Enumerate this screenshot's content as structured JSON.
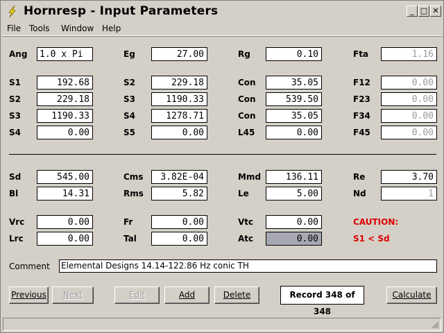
{
  "window": {
    "title": "Hornresp - Input Parameters",
    "controls": {
      "minimize": "_",
      "maximize": "□",
      "close": "✕"
    }
  },
  "menu": [
    "File",
    "Tools",
    "Window",
    "Help"
  ],
  "labels": {
    "ang": "Ang",
    "eg": "Eg",
    "rg": "Rg",
    "fta": "Fta",
    "c1_s1": "S1",
    "c1_s2": "S2",
    "c1_s3": "S3",
    "c1_s4": "S4",
    "c2_s2": "S2",
    "c2_s3": "S3",
    "c2_s4": "S4",
    "c2_s5": "S5",
    "con1": "Con",
    "con2": "Con",
    "con3": "Con",
    "l45": "L45",
    "f12": "F12",
    "f23": "F23",
    "f34": "F34",
    "f45": "F45",
    "sd": "Sd",
    "bl": "Bl",
    "cms": "Cms",
    "rms": "Rms",
    "mmd": "Mmd",
    "le": "Le",
    "re": "Re",
    "nd": "Nd",
    "vrc": "Vrc",
    "lrc": "Lrc",
    "fr": "Fr",
    "tal": "Tal",
    "vtc": "Vtc",
    "atc": "Atc",
    "comment": "Comment"
  },
  "values": {
    "ang": "1.0 x Pi",
    "eg": "27.00",
    "rg": "0.10",
    "fta": "1.16",
    "c1_s1": "192.68",
    "c1_s2": "229.18",
    "c1_s3": "1190.33",
    "c1_s4": "0.00",
    "c2_s2": "229.18",
    "c2_s3": "1190.33",
    "c2_s4": "1278.71",
    "c2_s5": "0.00",
    "con1": "35.05",
    "con2": "539.50",
    "con3": "35.05",
    "l45": "0.00",
    "f12": "0.00",
    "f23": "0.00",
    "f34": "0.00",
    "f45": "0.00",
    "sd": "545.00",
    "bl": "14.31",
    "cms": "3.82E-04",
    "rms": "5.82",
    "mmd": "136.11",
    "le": "5.00",
    "re": "3.70",
    "nd": "1",
    "vrc": "0.00",
    "lrc": "0.00",
    "fr": "0.00",
    "tal": "0.00",
    "vtc": "0.00",
    "atc": "0.00"
  },
  "caution": {
    "title": "CAUTION:",
    "message": "S1 < Sd"
  },
  "comment": "Elemental Designs 14.14-122.86 Hz conic TH",
  "buttons": {
    "previous": "Previous",
    "next": "Next",
    "edit": "Edit",
    "add": "Add",
    "delete": "Delete",
    "calculate": "Calculate"
  },
  "record": "Record 348 of 348",
  "colors": {
    "caution": "#e00000",
    "window_bg": "#d4d0c8",
    "disabled_text": "#9a9a9a",
    "highlight_field": "#a8a8b4"
  }
}
